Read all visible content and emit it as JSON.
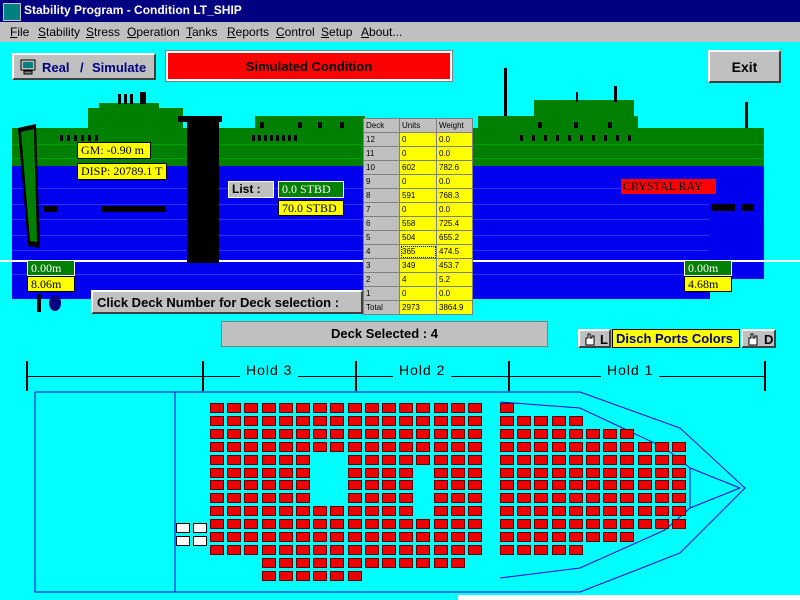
{
  "window": {
    "title": "Stability Program - Condition LT_SHIP"
  },
  "menu": [
    "File",
    "Stability",
    "Stress",
    "Operation",
    "Tanks",
    "Reports",
    "Control",
    "Setup",
    "About..."
  ],
  "toolbar": {
    "real_label": "Real",
    "separator": "/",
    "simulate_label": "Simulate",
    "condition_banner": "Simulated Condition",
    "exit_label": "Exit"
  },
  "ship": {
    "gm": "GM: -0.90 m",
    "disp": "DISP: 20789.1 T",
    "name": "CRYSTAL RAY",
    "list_label": "List  :",
    "list_value": "0.0 STBD",
    "list_value2": "70.0 STBD",
    "draft_left_top": "0.00m",
    "draft_left_bottom": "8.06m",
    "draft_right_top": "0.00m",
    "draft_right_bottom": "4.68m",
    "deck_prompt": "Click Deck  Number for   Deck selection :"
  },
  "deck_table": {
    "headers": [
      "Deck",
      "Units",
      "Weight"
    ],
    "rows": [
      {
        "deck": "12",
        "units": "0",
        "weight": "0.0"
      },
      {
        "deck": "11",
        "units": "0",
        "weight": "0.0"
      },
      {
        "deck": "10",
        "units": "602",
        "weight": "782.6"
      },
      {
        "deck": "9",
        "units": "0",
        "weight": "0.0"
      },
      {
        "deck": "8",
        "units": "591",
        "weight": "768.3"
      },
      {
        "deck": "7",
        "units": "0",
        "weight": "0.0"
      },
      {
        "deck": "6",
        "units": "558",
        "weight": "725.4"
      },
      {
        "deck": "5",
        "units": "504",
        "weight": "655.2"
      },
      {
        "deck": "4",
        "units": "365",
        "weight": "474.5"
      },
      {
        "deck": "3",
        "units": "349",
        "weight": "453.7"
      },
      {
        "deck": "2",
        "units": "4",
        "weight": "5.2"
      },
      {
        "deck": "1",
        "units": "0",
        "weight": "0.0"
      },
      {
        "deck": "Total",
        "units": "2973",
        "weight": "3864.9"
      }
    ],
    "selected_deck": "4"
  },
  "deck_selected": "Deck Selected : 4",
  "disch": {
    "left": "L",
    "label": "Disch Ports Colors",
    "right": "D"
  },
  "holds": [
    "Hold  3",
    "Hold  2",
    "Hold  1"
  ],
  "colors": {
    "cargo": "#ee0000",
    "hull_blue": "#0000ee",
    "hull_green": "#008000",
    "banner": "#ff0000",
    "background": "#00ffff"
  }
}
